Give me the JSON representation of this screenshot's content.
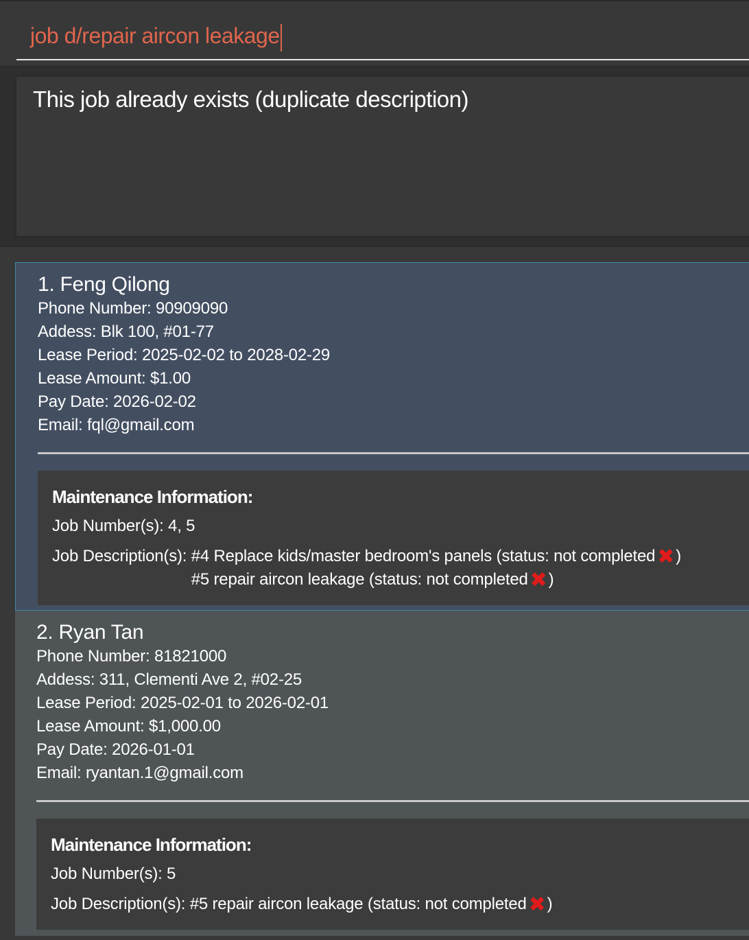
{
  "command": {
    "value": "job d/repair aircon leakage"
  },
  "result": {
    "message": "This job already exists (duplicate description)"
  },
  "icons": {
    "status_not_completed": "cross-mark-icon",
    "status_glyph": "✖"
  },
  "colors": {
    "command_text": "#e0664d",
    "selected_card": "#434f61",
    "card": "#4f5457",
    "cross_mark": "#e11b1b"
  },
  "tenants": [
    {
      "name": "1. Feng Qilong",
      "phone": "Phone Number:  90909090",
      "address": "Addess:  Blk 100, #01-77",
      "lease_period": "Lease Period: 2025-02-02 to 2028-02-29",
      "lease_amount": "Lease Amount: $1.00",
      "pay_date": "Pay Date: 2026-02-02",
      "email": "Email: fql@gmail.com",
      "maintenance": {
        "title": "Maintenance Information:",
        "job_numbers": "Job Number(s): 4, 5",
        "desc_label": "Job Description(s): ",
        "jobs": [
          {
            "text": "#4 Replace kids/master bedroom's panels (status: not completed",
            "close": ")"
          },
          {
            "text": "#5 repair aircon leakage (status: not completed",
            "close": ")"
          }
        ]
      }
    },
    {
      "name": "2. Ryan Tan",
      "phone": "Phone Number:  81821000",
      "address": "Addess:  311, Clementi Ave 2, #02-25",
      "lease_period": "Lease Period: 2025-02-01 to 2026-02-01",
      "lease_amount": "Lease Amount: $1,000.00",
      "pay_date": "Pay Date: 2026-01-01",
      "email": "Email: ryantan.1@gmail.com",
      "maintenance": {
        "title": "Maintenance Information:",
        "job_numbers": "Job Number(s): 5",
        "desc_label": "Job Description(s): ",
        "jobs": [
          {
            "text": "#5 repair aircon leakage (status: not completed",
            "close": ")"
          }
        ]
      }
    }
  ]
}
